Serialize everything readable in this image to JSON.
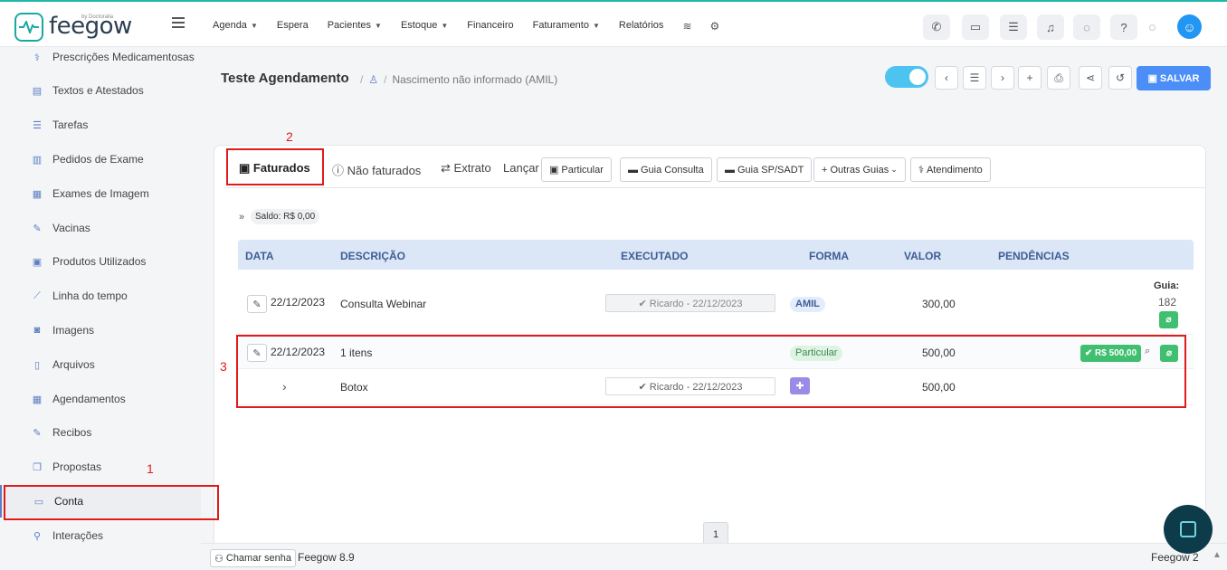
{
  "brand": {
    "name": "feegow",
    "by": "by Doctoralia"
  },
  "nav": {
    "items": [
      {
        "label": "Agenda",
        "caret": true
      },
      {
        "label": "Espera",
        "caret": false
      },
      {
        "label": "Pacientes",
        "caret": true
      },
      {
        "label": "Estoque",
        "caret": true
      },
      {
        "label": "Financeiro",
        "caret": false
      },
      {
        "label": "Faturamento",
        "caret": true
      },
      {
        "label": "Relatórios",
        "caret": false
      }
    ]
  },
  "sidebar": {
    "items": [
      {
        "label": "Prescrições Medicamentosas",
        "icon": "pills-icon"
      },
      {
        "label": "Textos e Atestados",
        "icon": "document-icon"
      },
      {
        "label": "Tarefas",
        "icon": "tasks-icon"
      },
      {
        "label": "Pedidos de Exame",
        "icon": "clipboard-icon"
      },
      {
        "label": "Exames de Imagem",
        "icon": "image-exam-icon"
      },
      {
        "label": "Vacinas",
        "icon": "syringe-icon"
      },
      {
        "label": "Produtos Utilizados",
        "icon": "box-icon"
      },
      {
        "label": "Linha do tempo",
        "icon": "timeline-icon"
      },
      {
        "label": "Imagens",
        "icon": "camera-icon"
      },
      {
        "label": "Arquivos",
        "icon": "file-icon"
      },
      {
        "label": "Agendamentos",
        "icon": "calendar-icon"
      },
      {
        "label": "Recibos",
        "icon": "receipt-icon"
      },
      {
        "label": "Propostas",
        "icon": "copy-icon"
      },
      {
        "label": "Conta",
        "icon": "money-icon"
      },
      {
        "label": "Interações",
        "icon": "link-icon"
      }
    ],
    "active": "Conta"
  },
  "page": {
    "title": "Teste Agendamento",
    "breadcrumb": "Nascimento não informado (AMIL)",
    "save_label": "SALVAR"
  },
  "tabs": {
    "faturados": "Faturados",
    "nao_faturados": "Não faturados",
    "extrato": "Extrato",
    "lancar": "Lançar"
  },
  "lancar_buttons": {
    "particular": "Particular",
    "guia_consulta": "Guia Consulta",
    "guia_sp_sadt": "Guia SP/SADT",
    "outras_guias": "Outras Guias",
    "atendimento": "Atendimento"
  },
  "saldo": {
    "arrow": "»",
    "label": "Saldo: R$ 0,00"
  },
  "table": {
    "headers": {
      "data": "DATA",
      "descricao": "DESCRIÇÃO",
      "executado": "EXECUTADO",
      "forma": "FORMA",
      "valor": "VALOR",
      "pendencias": "PENDÊNCIAS"
    },
    "rows": [
      {
        "date": "22/12/2023",
        "description": "Consulta Webinar",
        "executed": "✔ Ricardo - 22/12/2023",
        "forma": "AMIL",
        "valor": "300,00",
        "guia_label": "Guia:",
        "guia_number": "182"
      },
      {
        "date": "22/12/2023",
        "description": "1 itens",
        "forma": "Particular",
        "valor": "500,00",
        "paid": "✔ R$ 500,00"
      },
      {
        "expand": "›",
        "description": "Botox",
        "executed": "✔ Ricardo - 22/12/2023",
        "valor": "500,00"
      }
    ]
  },
  "annotations": {
    "one": "1",
    "two": "2",
    "three": "3"
  },
  "pagination": {
    "current": "1"
  },
  "footer": {
    "chamar_senha": "Chamar senha",
    "version": "Feegow 8.9",
    "feegow2": "Feegow 2"
  }
}
